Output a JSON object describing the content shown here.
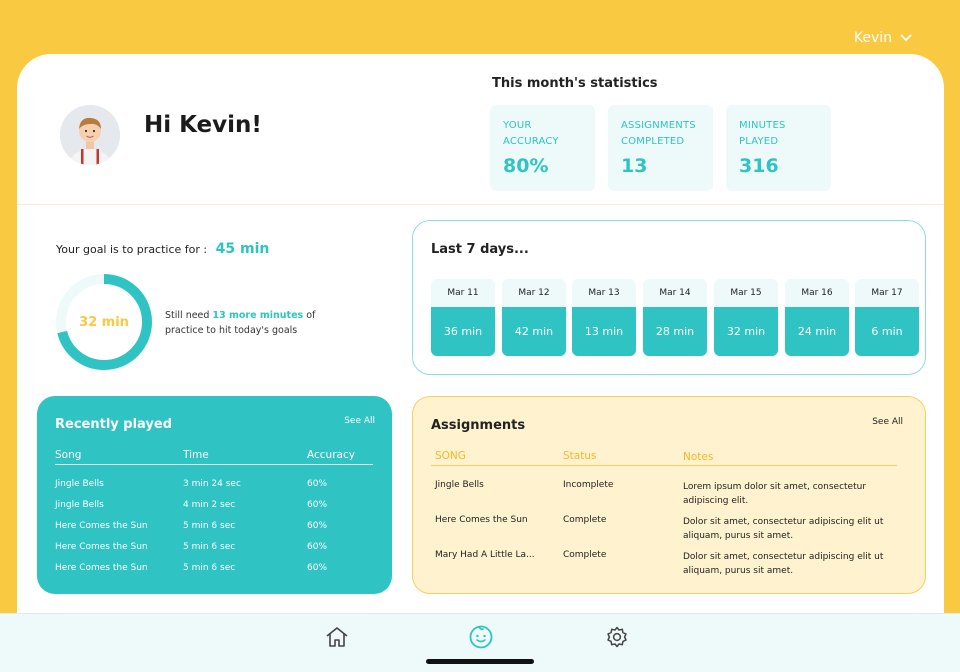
{
  "user": {
    "name": "Kevin"
  },
  "header": {
    "greeting": "Hi Kevin!",
    "stats_title": "This month's statistics",
    "stats": [
      {
        "label_line1": "YOUR",
        "label_line2": "ACCURACY",
        "value": "80%"
      },
      {
        "label_line1": "ASSIGNMENTS",
        "label_line2": "COMPLETED",
        "value": "13"
      },
      {
        "label_line1": "MINUTES",
        "label_line2": "PLAYED",
        "value": "316"
      }
    ]
  },
  "goal": {
    "text": "Your goal is to practice for :",
    "value": "45 min",
    "progress_text": "32 min",
    "progress_fraction": 0.711,
    "need_prefix": "Still need ",
    "need_highlight": "13 more minutes",
    "need_suffix": " of",
    "need_line2": "practice to hit today's goals"
  },
  "last7": {
    "title": "Last 7 days...",
    "days": [
      {
        "date": "Mar 11",
        "minutes": "36 min"
      },
      {
        "date": "Mar 12",
        "minutes": "42 min"
      },
      {
        "date": "Mar 13",
        "minutes": "13 min"
      },
      {
        "date": "Mar 14",
        "minutes": "28 min"
      },
      {
        "date": "Mar 15",
        "minutes": "32 min"
      },
      {
        "date": "Mar 16",
        "minutes": "24 min"
      },
      {
        "date": "Mar 17",
        "minutes": "6 min"
      }
    ]
  },
  "recent": {
    "title": "Recently played",
    "see_all": "See  All",
    "columns": [
      "Song",
      "Time",
      "Accuracy"
    ],
    "rows": [
      [
        "Jingle Bells",
        "3 min 24 sec",
        "60%"
      ],
      [
        "Jingle Bells",
        "4 min 2 sec",
        "60%"
      ],
      [
        "Here Comes the Sun",
        "5 min 6 sec",
        "60%"
      ],
      [
        "Here Comes the Sun",
        "5 min 6 sec",
        "60%"
      ],
      [
        "Here Comes the Sun",
        "5 min 6 sec",
        "60%"
      ]
    ]
  },
  "assignments": {
    "title": "Assignments",
    "see_all": "See  All",
    "columns": [
      "SONG",
      "Status",
      "Notes"
    ],
    "rows": [
      [
        "Jingle Bells",
        "Incomplete",
        "Lorem ipsum dolor sit amet, consectetur adipiscing elit."
      ],
      [
        "Here Comes the Sun",
        "Complete",
        "Dolor sit amet, consectetur adipiscing elit ut aliquam, purus sit amet."
      ],
      [
        "Mary Had A Little La...",
        "Complete",
        "Dolor sit amet, consectetur adipiscing elit ut aliquam, purus sit amet."
      ]
    ]
  },
  "nav": {
    "items": [
      {
        "icon": "home-icon"
      },
      {
        "icon": "kid-face-icon"
      },
      {
        "icon": "gear-icon"
      }
    ]
  },
  "colors": {
    "accent": "#2fc3c3",
    "brand_yellow": "#f9c941",
    "soft_teal": "#eefafa",
    "soft_yellow": "#fef2cf"
  }
}
